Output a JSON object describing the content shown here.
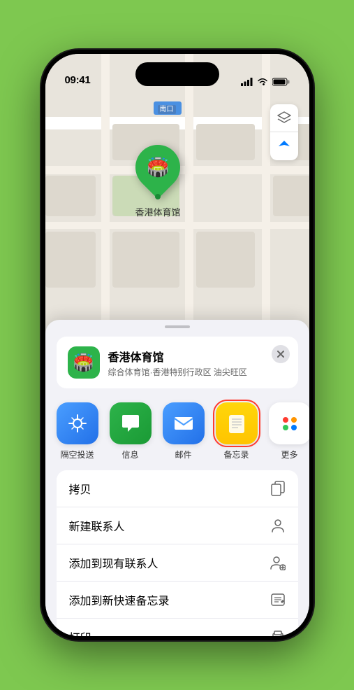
{
  "status_bar": {
    "time": "09:41",
    "signal_label": "signal",
    "wifi_label": "wifi",
    "battery_label": "battery"
  },
  "map": {
    "label_text": "南口",
    "location_name": "香港体育馆",
    "map_control_layers": "图层",
    "map_control_location": "定位"
  },
  "venue_card": {
    "name": "香港体育馆",
    "description": "综合体育馆·香港特别行政区 油尖旺区",
    "close_label": "×"
  },
  "share_apps": [
    {
      "id": "airdrop",
      "label": "隔空投送",
      "bg": "#4a9eff",
      "icon": "📡"
    },
    {
      "id": "messages",
      "label": "信息",
      "bg": "#2db34a",
      "icon": "💬"
    },
    {
      "id": "mail",
      "label": "邮件",
      "bg": "#4a9eff",
      "icon": "✉️"
    },
    {
      "id": "notes",
      "label": "备忘录",
      "bg": "#ffd60a",
      "icon": "📝",
      "selected": true
    }
  ],
  "more_apps_label": "更多",
  "action_items": [
    {
      "id": "copy",
      "label": "拷贝",
      "icon": "📋"
    },
    {
      "id": "new-contact",
      "label": "新建联系人",
      "icon": "👤"
    },
    {
      "id": "add-contact",
      "label": "添加到现有联系人",
      "icon": "👤+"
    },
    {
      "id": "quick-notes",
      "label": "添加到新快速备忘录",
      "icon": "📝"
    },
    {
      "id": "print",
      "label": "打印",
      "icon": "🖨️"
    }
  ],
  "colors": {
    "green": "#2db34a",
    "blue": "#4a9eff",
    "yellow": "#ffd60a",
    "red": "#ff3b30",
    "bg_green": "#7ec850"
  }
}
